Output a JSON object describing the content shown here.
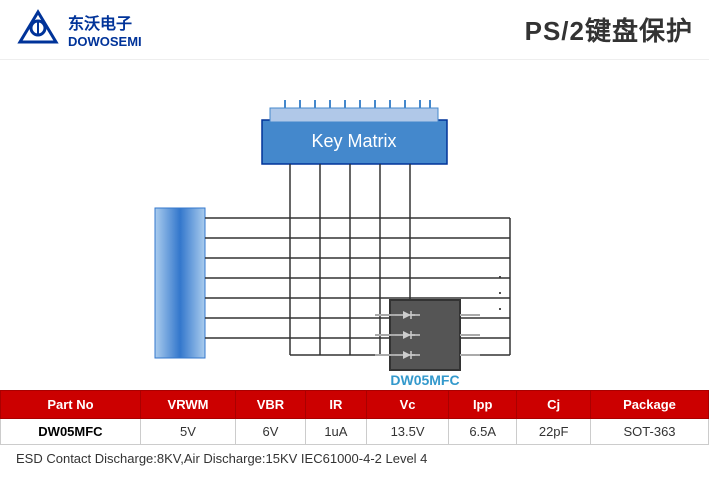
{
  "header": {
    "company_cn": "东沃电子",
    "company_en": "DOWOSEMI",
    "page_title": "PS/2键盘保护"
  },
  "diagram": {
    "key_matrix_label": "Key Matrix",
    "ic_label": "DW05MFC"
  },
  "table": {
    "headers": [
      "Part No",
      "VRWM",
      "VBR",
      "IR",
      "Vc",
      "Ipp",
      "Cj",
      "Package"
    ],
    "rows": [
      [
        "DW05MFC",
        "5V",
        "6V",
        "1uA",
        "13.5V",
        "6.5A",
        "22pF",
        "SOT-363"
      ]
    ]
  },
  "footer": {
    "text": "ESD Contact Discharge:8KV,Air Discharge:15KV  IEC61000-4-2 Level 4"
  }
}
